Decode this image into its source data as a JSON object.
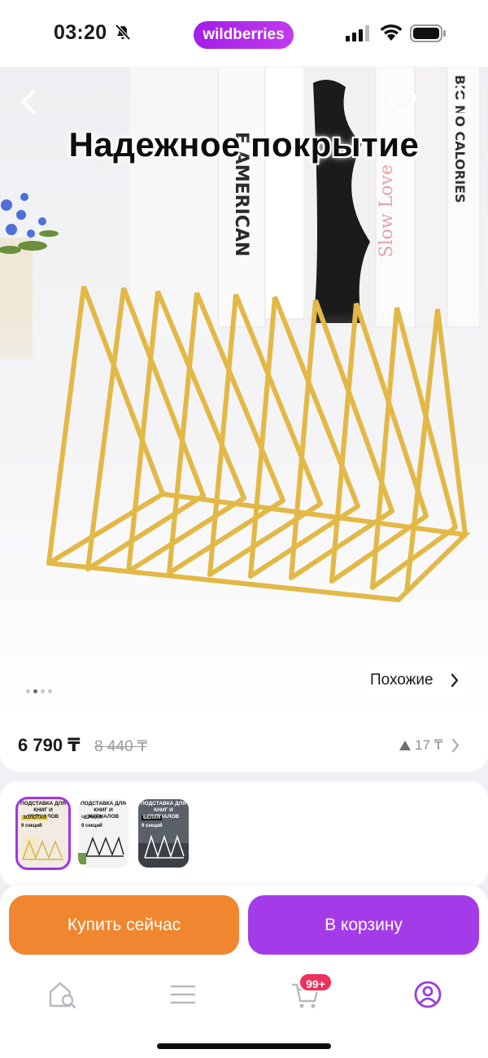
{
  "status_bar": {
    "time": "03:20",
    "brand": "wildberries"
  },
  "hero": {
    "title": "Надежное покрытие",
    "similar_label": "Похожие",
    "slide_count": 4,
    "active_slide": 1
  },
  "price": {
    "current": "6 790 ₸",
    "old": "8 440 ₸",
    "delta": "17 ₸"
  },
  "variants": [
    {
      "header": "ПОДСТАВКА ДЛЯ КНИГ И ЖУРНАЛОВ",
      "color_label": "ЗОЛОТАЯ",
      "sections": "9 секций",
      "selected": true
    },
    {
      "header": "ПОДСТАВКА ДЛЯ КНИГ И ЖУРНАЛОВ",
      "color_label": "ЧЕРНАЯ",
      "sections": "9 секций",
      "selected": false
    },
    {
      "header": "ПОДСТАВКА ДЛЯ КНИГ И ЖУРНАЛОВ",
      "color_label": "БЕЛАЯ",
      "sections": "9 секций",
      "selected": false
    }
  ],
  "actions": {
    "buy_now": "Купить сейчас",
    "add_to_cart": "В корзину"
  },
  "tab_bar": {
    "cart_badge": "99+"
  },
  "colors": {
    "brand_purple": "#a43be9",
    "buy_orange": "#f0862f",
    "badge_red": "#f0305a",
    "gold": "#e8bf45"
  }
}
